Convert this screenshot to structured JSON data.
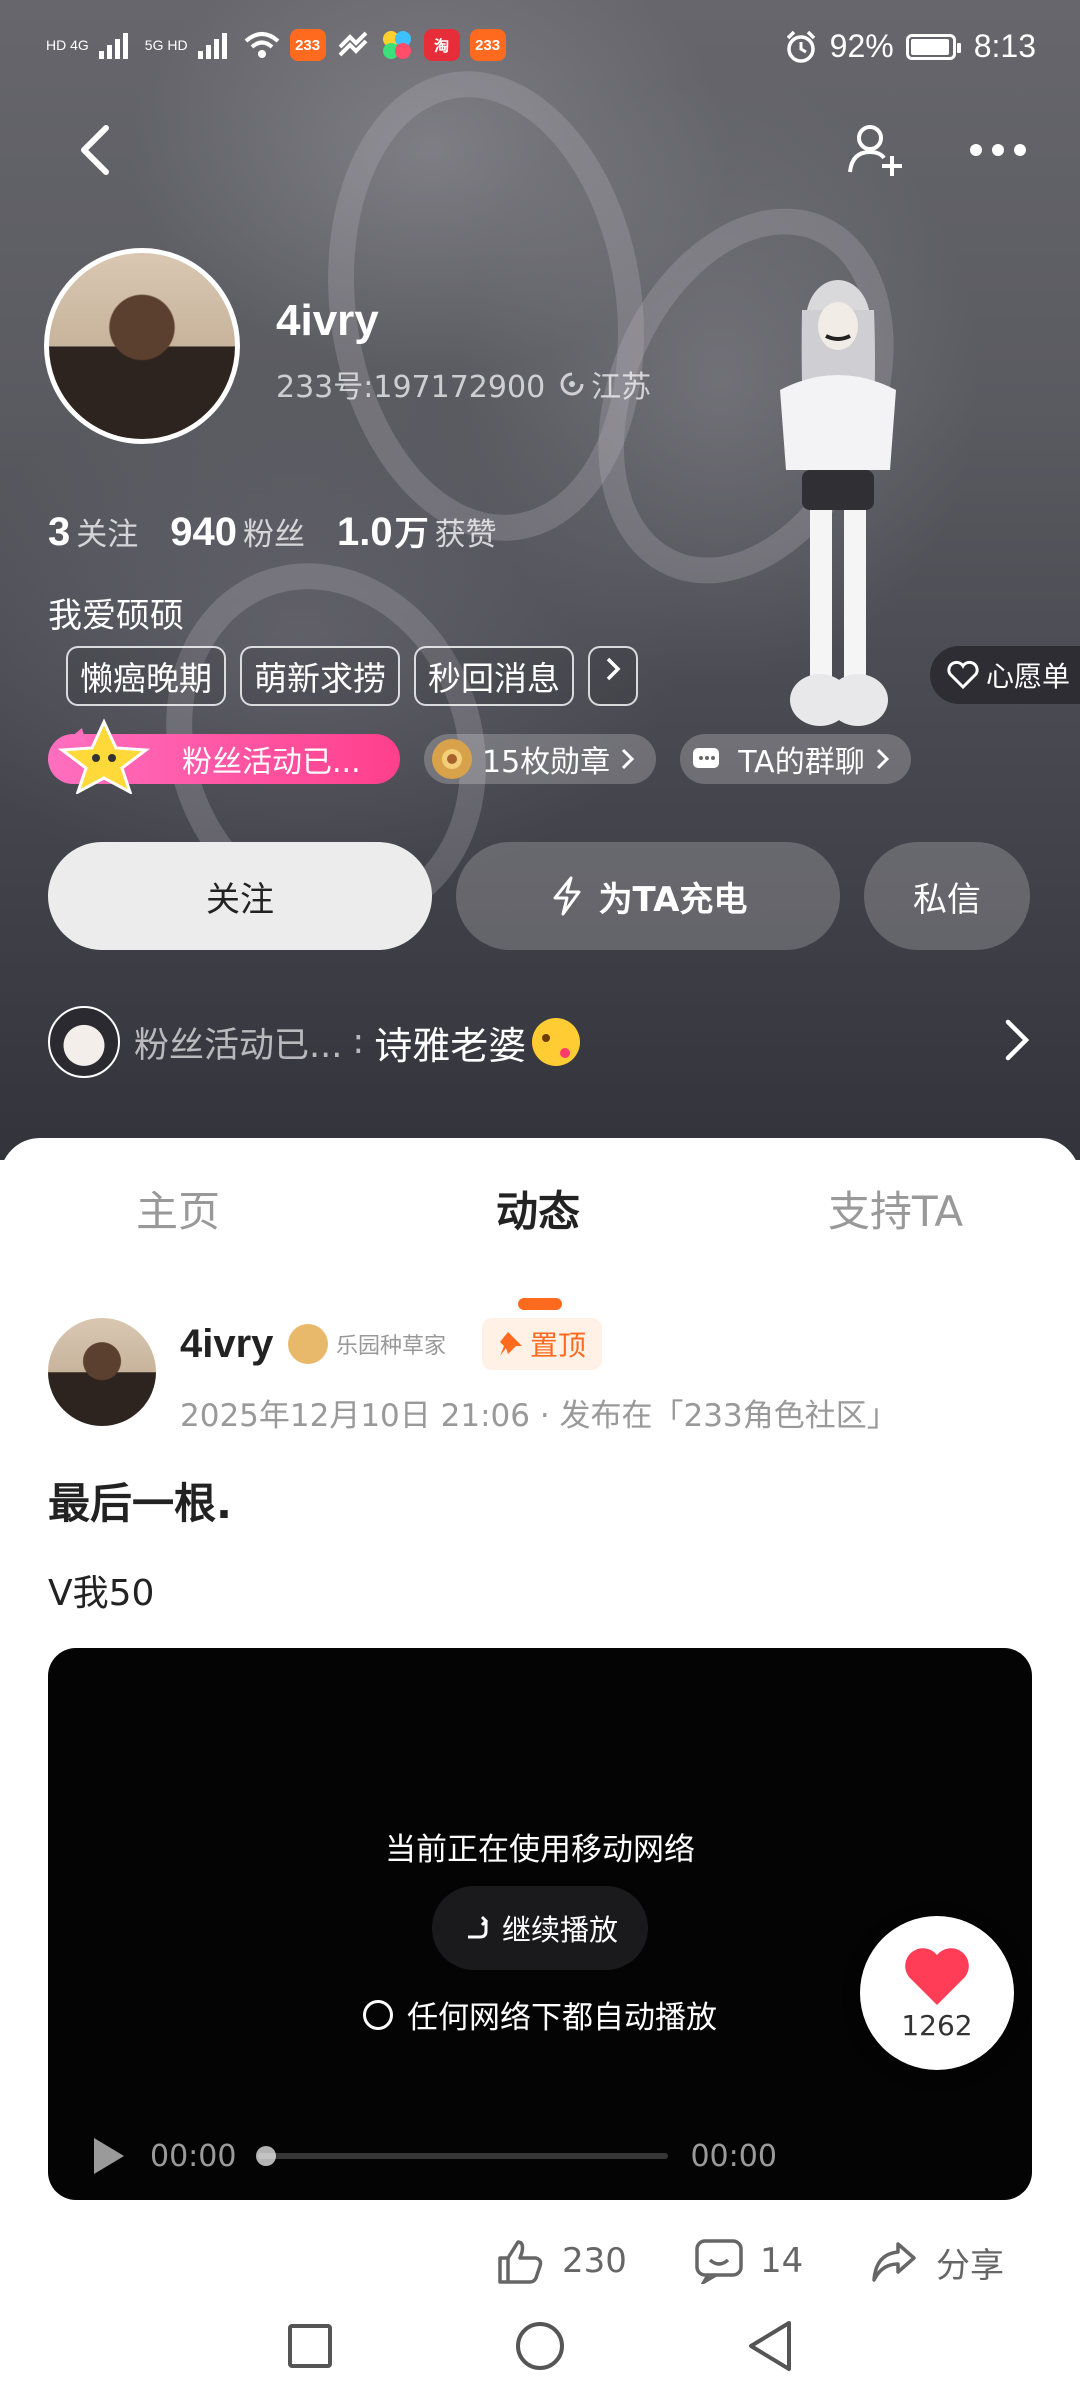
{
  "statusbar": {
    "battery": "92%",
    "time": "8:13",
    "apps": [
      "233",
      "233"
    ],
    "signal": [
      "HD 4G",
      "5G HD"
    ]
  },
  "profile": {
    "name": "4ivry",
    "uid": "233号:197172900",
    "location": "江苏",
    "stats": [
      {
        "num": "3",
        "label": "关注"
      },
      {
        "num": "940",
        "label": "粉丝"
      },
      {
        "num": "1.0",
        "unit": "万",
        "label": "获赞"
      }
    ],
    "bio": "我爱硕硕",
    "tags": [
      "懒癌晚期",
      "萌新求捞",
      "秒回消息"
    ],
    "wishlist": "心愿单",
    "badges": {
      "fan_activity": "粉丝活动已...",
      "medals": "15枚勋章",
      "group": "TA的群聊"
    },
    "buttons": {
      "follow": "关注",
      "charge": "为TA充电",
      "message": "私信"
    },
    "fan_row": {
      "label": "粉丝活动已...",
      "colon": ":",
      "message": "诗雅老婆"
    }
  },
  "tabs": [
    {
      "label": "主页",
      "active": false
    },
    {
      "label": "动态",
      "active": true
    },
    {
      "label": "支持TA",
      "active": false
    }
  ],
  "post": {
    "author": "4ivry",
    "author_badge": "乐园种草家",
    "pinned": "置顶",
    "meta": "2025年12月10日 21:06 · 发布在「233角色社区」",
    "title": "最后一根.",
    "text": "V我50",
    "video": {
      "network_notice": "当前正在使用移动网络",
      "continue_label": "继续播放",
      "auto_play_label": "任何网络下都自动播放",
      "time_current": "00:00",
      "time_total": "00:00",
      "progress": 0
    },
    "like_float_count": "1262",
    "actions": [
      {
        "icon": "thumbs-up-icon",
        "label": "230"
      },
      {
        "icon": "comment-icon",
        "label": "14"
      },
      {
        "icon": "share-icon",
        "label": "分享"
      }
    ]
  },
  "colors": {
    "accent": "#ff6a1f",
    "fan_badge": "#ff4f9e",
    "heart": "#ff3d57"
  }
}
